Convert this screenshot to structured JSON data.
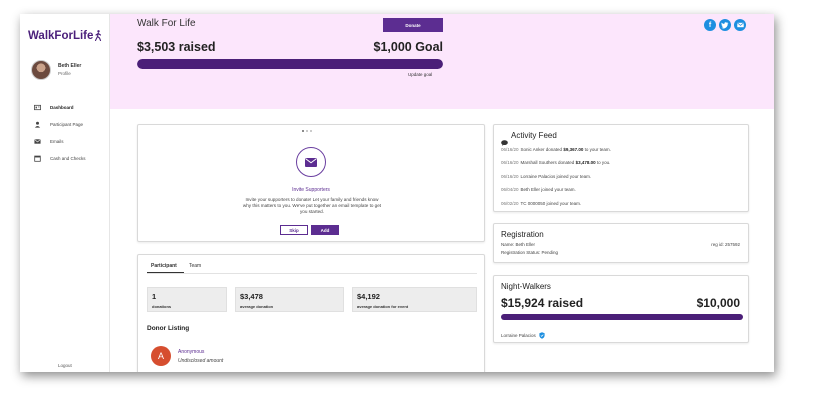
{
  "app": {
    "logo_text": "WalkForLife"
  },
  "user": {
    "name": "Beth Eller",
    "subtitle": "Profile"
  },
  "nav": {
    "items": [
      {
        "label": "Dashboard",
        "icon": "dashboard-icon"
      },
      {
        "label": "Participant Page",
        "icon": "person-icon"
      },
      {
        "label": "Emails",
        "icon": "envelope-icon"
      },
      {
        "label": "Cash and Checks",
        "icon": "calendar-icon"
      }
    ],
    "logout": "Logout"
  },
  "header": {
    "title": "Walk For Life",
    "donate_label": "Donate",
    "raised_text": "$3,503 raised",
    "goal_text": "$1,000  Goal",
    "progress_fraction": 1.0,
    "update_goal": "Update goal",
    "social_icons": [
      "facebook-icon",
      "twitter-icon",
      "email-icon"
    ]
  },
  "invite": {
    "title": "Invite Supporters",
    "text": "Invite your supporters to donate! Let your family and friends know why this matters to you. We've put together an email template to get you started.",
    "skip_label": "Skip",
    "add_label": "Add"
  },
  "stats": {
    "tabs": [
      "Participant",
      "Team"
    ],
    "boxes": [
      {
        "value": "1",
        "label": "donations"
      },
      {
        "value": "$3,478",
        "label": "average donation"
      },
      {
        "value": "$4,192",
        "label": "average donation for event"
      }
    ],
    "donor_heading": "Donor Listing",
    "donor": {
      "initial": "A",
      "name": "Anonymous",
      "amount": "Undisclosed amount"
    }
  },
  "activity": {
    "title": "Activity Feed",
    "items": [
      {
        "date": "06/16/20",
        "pre": "Sonic Anker donated",
        "amount": "$9,367.00",
        "post": "to your team."
      },
      {
        "date": "06/16/20",
        "pre": "Marshall Southers donated",
        "amount": "$3,478.00",
        "post": "to you."
      },
      {
        "date": "06/16/20",
        "pre": "Lorraine Palacios joined your team.",
        "amount": "",
        "post": ""
      },
      {
        "date": "06/04/20",
        "pre": "Beth Eller joined your team.",
        "amount": "",
        "post": ""
      },
      {
        "date": "06/02/20",
        "pre": "TC 0000050 joined your team.",
        "amount": "",
        "post": ""
      }
    ]
  },
  "registration": {
    "title": "Registration",
    "name_line": "Name: Beth Eller",
    "status_line": "Registration Status: Pending",
    "reg_id": "reg id: 257592"
  },
  "team": {
    "title": "Night-Walkers",
    "raised_text": "$15,924 raised",
    "goal_text": "$10,000",
    "progress_fraction": 1.0,
    "member": "Lorraine Palacios"
  },
  "colors": {
    "brand": "#5c2d91",
    "progress": "#4b1f78",
    "header_bg": "#fce6fc",
    "social": "#1d8fe0",
    "donor_avatar": "#d64e2f"
  }
}
